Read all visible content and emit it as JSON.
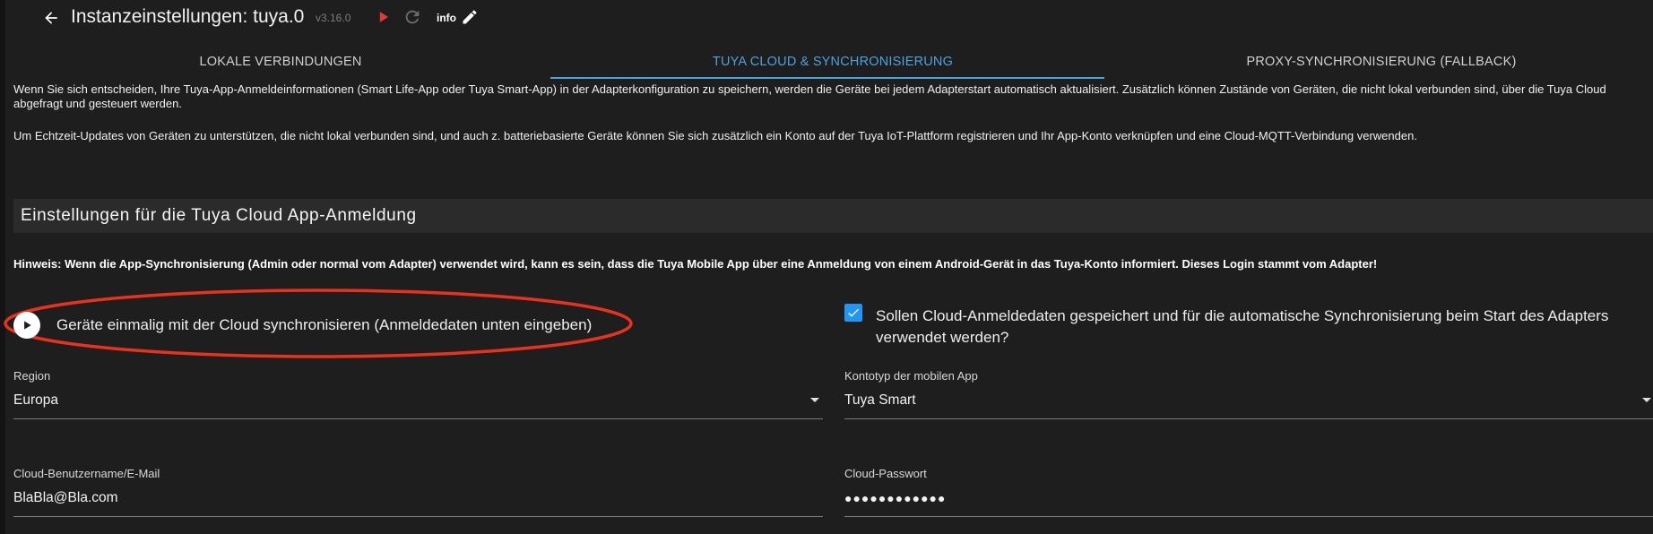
{
  "header": {
    "title": "Instanzeinstellungen: tuya.0",
    "version": "v3.16.0",
    "info_label": "info"
  },
  "tabs": [
    {
      "label": "LOKALE VERBINDUNGEN",
      "active": false
    },
    {
      "label": "TUYA CLOUD & SYNCHRONISIERUNG",
      "active": true
    },
    {
      "label": "PROXY-SYNCHRONISIERUNG (FALLBACK)",
      "active": false
    }
  ],
  "intro": {
    "paragraph1": "Wenn Sie sich entscheiden, Ihre Tuya-App-Anmeldeinformationen (Smart Life-App oder Tuya Smart-App) in der Adapterkonfiguration zu speichern, werden die Geräte bei jedem Adapterstart automatisch aktualisiert. Zusätzlich können Zustände von Geräten, die nicht lokal verbunden sind, über die Tuya Cloud abgefragt und gesteuert werden.",
    "paragraph2": "Um Echtzeit-Updates von Geräten zu unterstützen, die nicht lokal verbunden sind, und auch z. batteriebasierte Geräte können Sie sich zusätzlich ein Konto auf der Tuya IoT-Plattform registrieren und Ihr App-Konto verknüpfen und eine Cloud-MQTT-Verbindung verwenden."
  },
  "section": {
    "title": "Einstellungen für die Tuya Cloud App-Anmeldung",
    "hint": "Hinweis: Wenn die App-Synchronisierung (Admin oder normal vom Adapter) verwendet wird, kann es sein, dass die Tuya Mobile App über eine Anmeldung von einem Android-Gerät in das Tuya-Konto informiert. Dieses Login stammt vom Adapter!"
  },
  "sync_button": {
    "label": "Geräte einmalig mit der Cloud synchronisieren (Anmeldedaten unten eingeben)"
  },
  "save_credentials": {
    "checked": true,
    "label": "Sollen Cloud-Anmeldedaten gespeichert und für die automatische Synchronisierung beim Start des Adapters verwendet werden?"
  },
  "fields": {
    "region": {
      "label": "Region",
      "value": "Europa"
    },
    "account_type": {
      "label": "Kontotyp der mobilen App",
      "value": "Tuya Smart"
    },
    "username": {
      "label": "Cloud-Benutzername/E-Mail",
      "value": "BlaBla@Bla.com"
    },
    "password": {
      "label": "Cloud-Passwort",
      "value": "●●●●●●●●●●●●"
    }
  },
  "colors": {
    "accent": "#4aa3df",
    "checkbox": "#2196f3",
    "highlight": "#e8321e",
    "play": "#e53935"
  }
}
